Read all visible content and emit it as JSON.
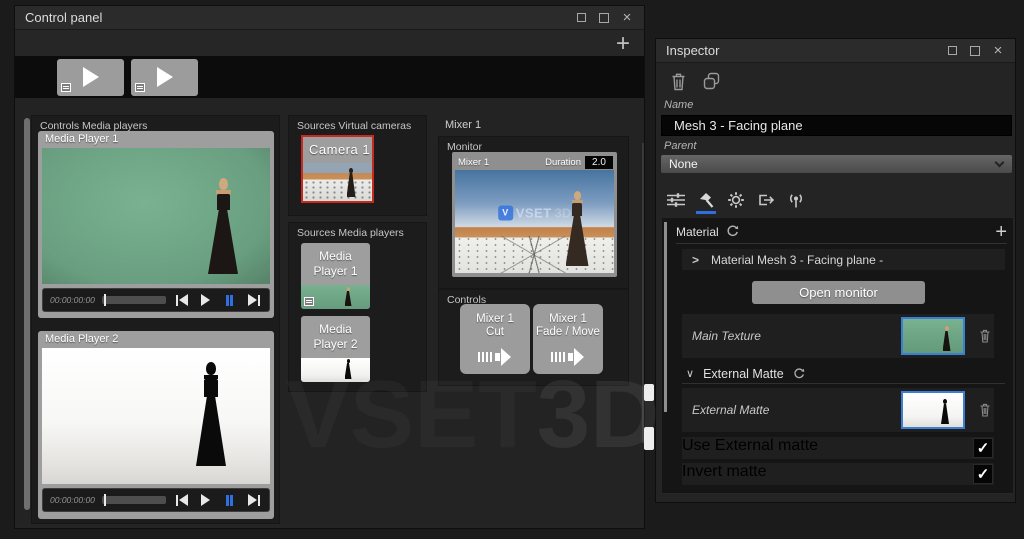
{
  "icons": {
    "close": "×",
    "add": "+",
    "chevron_expand": ">",
    "chevron_open": "∨",
    "check": "✓"
  },
  "watermark": {
    "text_left": "VSET",
    "text_right": "3D"
  },
  "control_panel": {
    "title": "Control panel",
    "groups": {
      "media_players_label": "Controls Media players",
      "virtual_cameras_label": "Sources Virtual cameras",
      "sources_media_label": "Sources Media players",
      "mixer_label": "Mixer 1",
      "monitor_label": "Monitor",
      "controls_label": "Controls"
    },
    "players": [
      {
        "name": "Media Player 1",
        "timecode": "00:00:00:00"
      },
      {
        "name": "Media Player 2",
        "timecode": "00:00:00:00"
      }
    ],
    "camera_source": {
      "name": "Camera 1"
    },
    "media_sources": [
      {
        "line1": "Media",
        "line2": "Player 1"
      },
      {
        "line1": "Media",
        "line2": "Player 2"
      }
    ],
    "mixer": {
      "monitor_title": "Mixer 1",
      "duration_label": "Duration",
      "duration_value": "2.0",
      "logo_badge": "V",
      "logo_text": "VSET",
      "logo_3d": "3D",
      "cut_line1": "Mixer 1",
      "cut_line2": "Cut",
      "fade_line1": "Mixer 1",
      "fade_line2": "Fade / Move"
    }
  },
  "inspector": {
    "title": "Inspector",
    "name_label": "Name",
    "name_value": "Mesh 3 - Facing plane",
    "parent_label": "Parent",
    "parent_value": "None",
    "material_header": "Material",
    "material_item": "Material Mesh 3 - Facing plane -",
    "open_monitor": "Open monitor",
    "main_texture_label": "Main Texture",
    "external_matte_header": "External Matte",
    "external_matte_label": "External Matte",
    "use_external_matte_label": "Use External matte",
    "invert_matte_label": "Invert matte"
  },
  "colors": {
    "accent_blue": "#2f6fe0",
    "selection_red": "#c62a21",
    "thumbnail_border": "#3a7fd5"
  }
}
